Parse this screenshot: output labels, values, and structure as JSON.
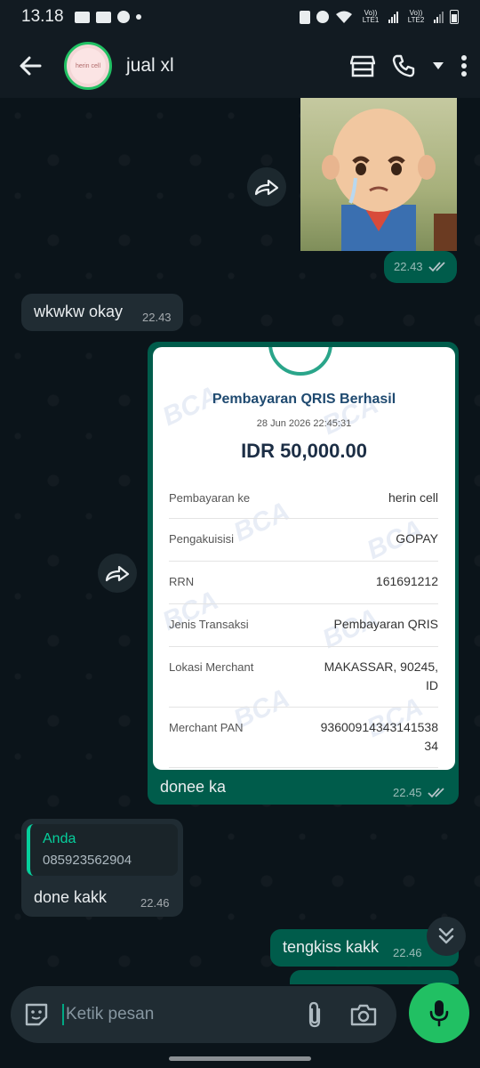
{
  "status_bar": {
    "time": "13.18",
    "sim1": "Vo)) LTE1",
    "sim2": "Vo)) LTE2"
  },
  "header": {
    "contact_name": "jual xl",
    "avatar_text": "herin cell"
  },
  "messages": {
    "sticker_time": "22.43",
    "m1_text": "wkwkw okay",
    "m1_time": "22.43",
    "receipt": {
      "title": "Pembayaran QRIS Berhasil",
      "datetime": "28 Jun 2026 22:45:31",
      "amount": "IDR 50,000.00",
      "watermark": "BCA",
      "rows": [
        {
          "label": "Pembayaran ke",
          "value": "herin cell"
        },
        {
          "label": "Pengakuisisi",
          "value": "GOPAY"
        },
        {
          "label": "RRN",
          "value": "161691212"
        },
        {
          "label": "Jenis Transaksi",
          "value": "Pembayaran QRIS"
        },
        {
          "label": "Lokasi Merchant",
          "value": "MAKASSAR, 90245,",
          "value2": "ID"
        },
        {
          "label": "Merchant PAN",
          "value": "9360091434314153​8",
          "value2": "34"
        }
      ]
    },
    "m2_caption": "donee ka",
    "m2_time": "22.45",
    "m3_quote_author": "Anda",
    "m3_quote_text": "085923562904",
    "m3_text": "done kakk",
    "m3_time": "22.46",
    "m4_text": "tengkiss kakk",
    "m4_time": "22.46"
  },
  "composer": {
    "placeholder": "Ketik pesan"
  },
  "colors": {
    "accent": "#21c063",
    "outgoing_bubble": "#005c4b",
    "incoming_bubble": "#202c33",
    "background": "#0b141a"
  },
  "icons": [
    "back-arrow-icon",
    "shop-icon",
    "phone-icon",
    "dropdown-icon",
    "more-vert-icon",
    "forward-icon",
    "double-check-icon",
    "sticker-icon",
    "attach-icon",
    "camera-icon",
    "mic-icon",
    "chevron-double-down-icon"
  ]
}
